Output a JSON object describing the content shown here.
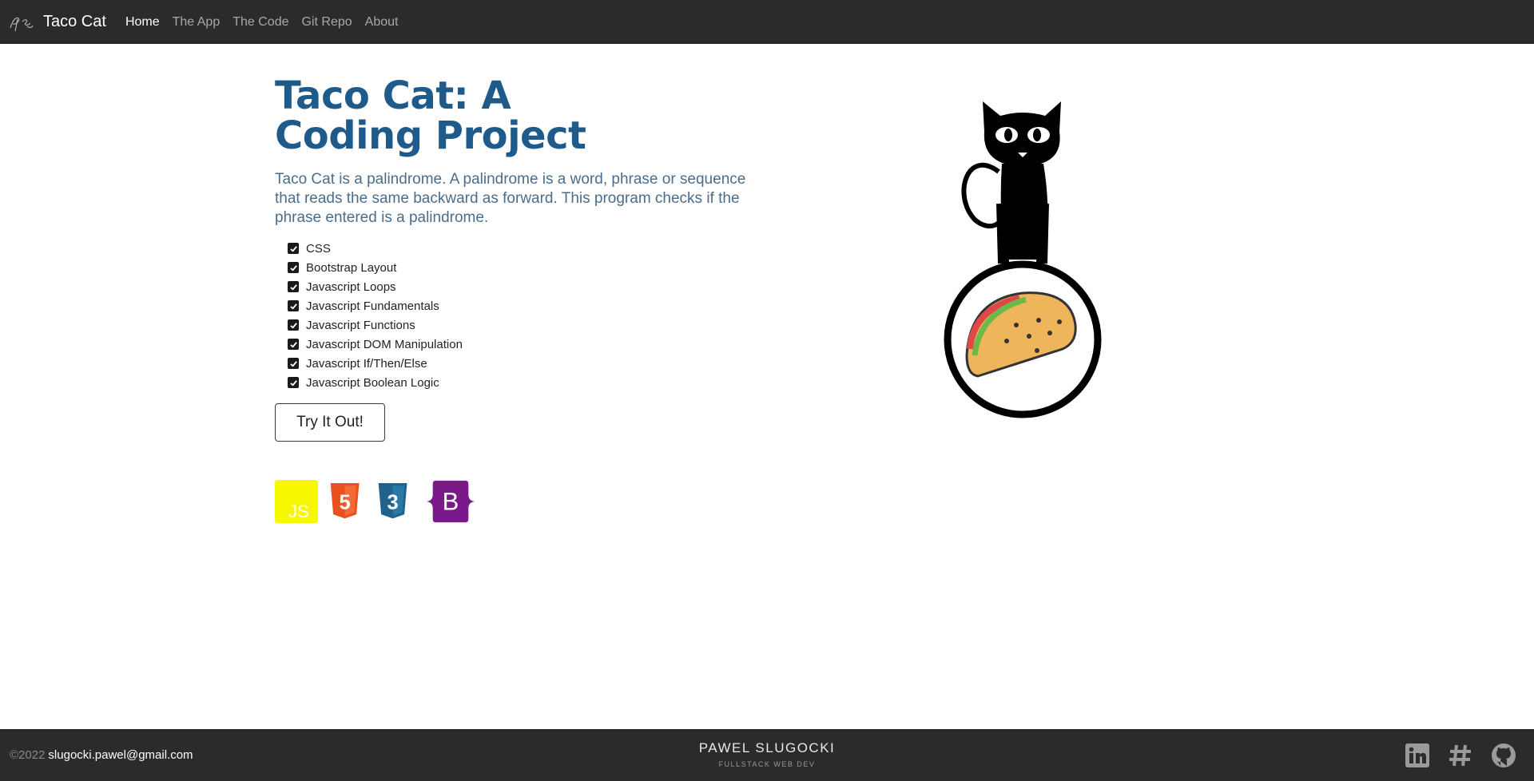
{
  "nav": {
    "brand": "Taco Cat",
    "links": [
      {
        "label": "Home",
        "active": true
      },
      {
        "label": "The App",
        "active": false
      },
      {
        "label": "The Code",
        "active": false
      },
      {
        "label": "Git Repo",
        "active": false
      },
      {
        "label": "About",
        "active": false
      }
    ]
  },
  "hero": {
    "title": "Taco Cat: A Coding Project",
    "lead": "Taco Cat is a palindrome. A palindrome is a word, phrase or sequence that reads the same backward as forward. This program checks if the phrase entered is a palindrome.",
    "skills": [
      "CSS",
      "Bootstrap Layout",
      "Javascript Loops",
      "Javascript Fundamentals",
      "Javascript Functions",
      "Javascript DOM Manipulation",
      "Javascript If/Then/Else",
      "Javascript Boolean Logic"
    ],
    "cta": "Try It Out!",
    "tech_icons": [
      {
        "name": "javascript-icon",
        "label": "JS",
        "color": "#f7f700"
      },
      {
        "name": "html5-icon",
        "label": "5",
        "color": "#e8501e"
      },
      {
        "name": "css3-icon",
        "label": "3",
        "color": "#21628a"
      },
      {
        "name": "bootstrap-icon",
        "label": "B",
        "color": "#7a1a8a"
      }
    ]
  },
  "footer": {
    "copyright": "©2022",
    "email": "slugocki.pawel@gmail.com",
    "name": "PAWEL SLUGOCKI",
    "tagline": "FULLSTACK WEB DEV",
    "social": [
      "linkedin-icon",
      "hashtag-icon",
      "github-icon"
    ]
  },
  "colors": {
    "navbar_bg": "#2b2b2b",
    "title": "#1e5a8a",
    "lead": "#4c6d8a"
  }
}
